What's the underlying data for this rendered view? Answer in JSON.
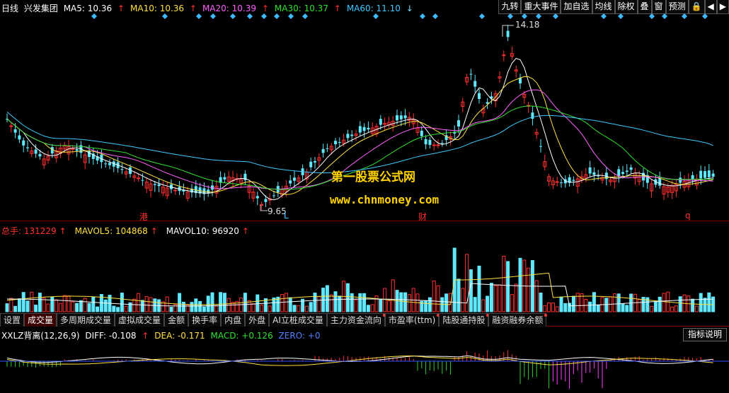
{
  "main": {
    "period": "日线",
    "stock": "兴发集团",
    "ma": [
      {
        "label": "MA5: 10.36",
        "color": "#ffffff",
        "arrow": "↑"
      },
      {
        "label": "MA10: 10.36",
        "color": "#ffe040",
        "arrow": "↑"
      },
      {
        "label": "MA20: 10.39",
        "color": "#ff60ff",
        "arrow": "↑"
      },
      {
        "label": "MA30: 10.37",
        "color": "#30e030",
        "arrow": "↑"
      },
      {
        "label": "MA60: 11.10",
        "color": "#40c8ff",
        "arrow": "↓"
      }
    ],
    "high_label": "14.18",
    "low_label": "9.65",
    "markers": [
      "港",
      "L",
      "财",
      "q"
    ]
  },
  "toolbar": [
    "九转",
    "重大事件",
    "加自选",
    "均线",
    "除权",
    "叠",
    "窗",
    "预测",
    "lock-icon",
    "back-icon",
    "forward-icon"
  ],
  "volume": {
    "total_label": "总手: 131229",
    "mavol5": "MAVOL5: 104868",
    "mavol10": "MAVOL10: 96920",
    "arrow": "↑"
  },
  "tabs": [
    {
      "label": "设置",
      "active": false,
      "dot": false
    },
    {
      "label": "成交量",
      "active": true,
      "dot": false
    },
    {
      "label": "多周期成交量",
      "active": false,
      "dot": false
    },
    {
      "label": "虚拟成交量",
      "active": false,
      "dot": false
    },
    {
      "label": "金额",
      "active": false,
      "dot": false
    },
    {
      "label": "换手率",
      "active": false,
      "dot": false
    },
    {
      "label": "内盘",
      "active": false,
      "dot": false
    },
    {
      "label": "外盘",
      "active": false,
      "dot": false
    },
    {
      "label": "AI立桩成交量",
      "active": false,
      "dot": false
    },
    {
      "label": "主力资金流向",
      "active": false,
      "dot": true
    },
    {
      "label": "市盈率(ttm)",
      "active": false,
      "dot": true
    },
    {
      "label": "陆股通持股",
      "active": false,
      "dot": true
    },
    {
      "label": "融资融券余额",
      "active": false,
      "dot": true
    }
  ],
  "indicator": {
    "name": "XXLZ背离(12,26,9)",
    "diff": "DIFF: -0.108",
    "dea": "DEA: -0.171",
    "macd": "MACD: +0.126",
    "zero": "ZERO: +0",
    "explain": "指标说明"
  },
  "watermark": {
    "line1": "第一股票公式网",
    "line2": "www.chnmoney.com"
  },
  "colors": {
    "up": "#ff3030",
    "down": "#60e8ff",
    "grid": "#7a0000"
  }
}
